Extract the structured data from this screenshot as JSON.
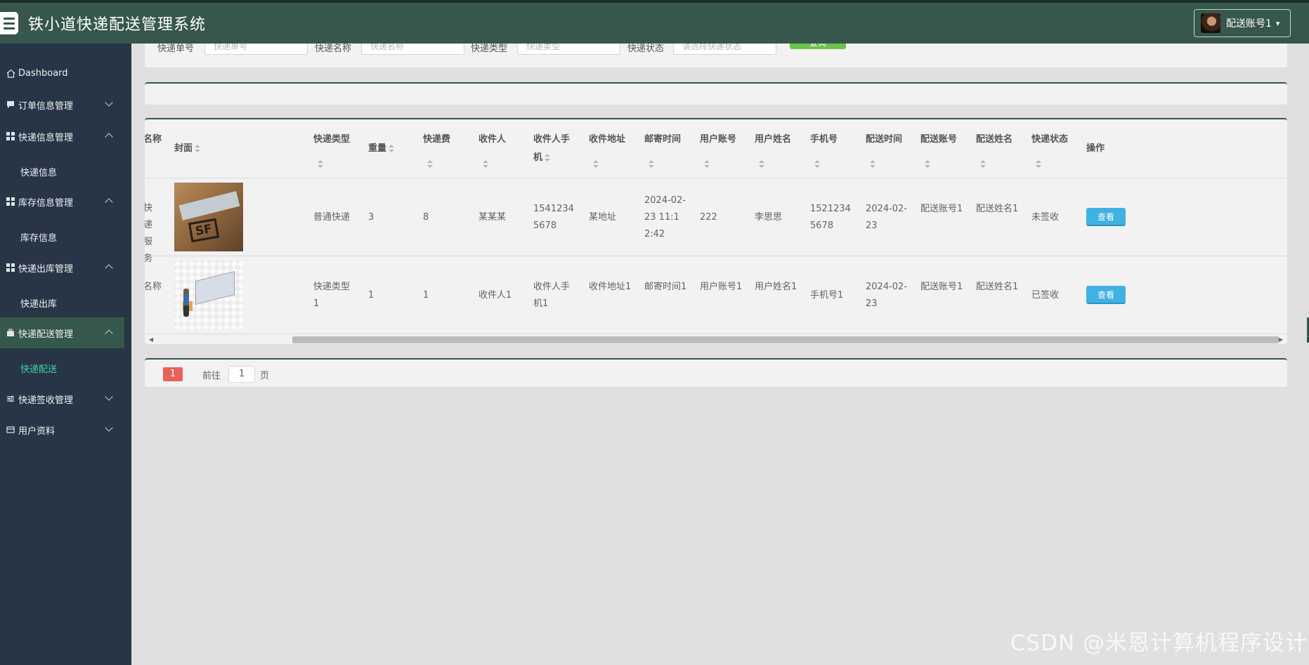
{
  "header": {
    "title": "铁小道快递配送管理系统",
    "user_label": "配送账号1",
    "caret": "▾"
  },
  "sidebar": {
    "items": [
      {
        "label": "Dashboard"
      },
      {
        "label": "订单信息管理"
      },
      {
        "label": "快递信息管理"
      },
      {
        "label": "快递信息"
      },
      {
        "label": "库存信息管理"
      },
      {
        "label": "库存信息"
      },
      {
        "label": "快递出库管理"
      },
      {
        "label": "快递出库"
      },
      {
        "label": "快递配送管理"
      },
      {
        "label": "快递配送"
      },
      {
        "label": "快递签收管理"
      },
      {
        "label": "用户资料"
      }
    ]
  },
  "search": {
    "labels": [
      "快递单号",
      "快递名称",
      "快递类型",
      "快递状态"
    ],
    "placeholders": [
      "快递单号",
      "快递名称",
      "快递类型",
      "请选择快递状态"
    ],
    "button": "查询"
  },
  "table": {
    "headers": [
      "名称",
      "封面",
      "快递类型",
      "重量",
      "快递费",
      "收件人",
      "收件人手机",
      "收件地址",
      "邮寄时间",
      "用户账号",
      "用户姓名",
      "手机号",
      "配送时间",
      "配送账号",
      "配送姓名",
      "快递状态",
      "操作"
    ],
    "rows": [
      {
        "name": "快递服务",
        "type": "普通快递",
        "weight": "3",
        "fee": "8",
        "receiver": "某某某",
        "receiver_phone": "15412345678",
        "address": "某地址",
        "mail_time": "2024-02-23 11:12:42",
        "user_account": "222",
        "user_name": "李思思",
        "phone": "15212345678",
        "delivery_time": "2024-02-23",
        "delivery_account": "配送账号1",
        "delivery_name": "配送姓名1",
        "status": "未签收",
        "action": "查看"
      },
      {
        "name": "名称",
        "type": "快递类型1",
        "weight": "1",
        "fee": "1",
        "receiver": "收件人1",
        "receiver_phone": "收件人手机1",
        "address": "收件地址1",
        "mail_time": "邮寄时间1",
        "user_account": "用户账号1",
        "user_name": "用户姓名1",
        "phone": "手机号1",
        "delivery_time": "2024-02-23",
        "delivery_account": "配送账号1",
        "delivery_name": "配送姓名1",
        "status": "已签收",
        "action": "查看"
      }
    ]
  },
  "pagination": {
    "current": "1",
    "goto_prefix": "前往",
    "goto_value": "1",
    "goto_suffix": "页"
  },
  "watermark": "CSDN @米恩计算机程序设计",
  "colors": {
    "header": "#36574a",
    "sidebar": "#273646",
    "active_sub": "#3fd3a6",
    "view_button": "#3fb1e3",
    "page_active": "#e8615a",
    "search_button": "#6cc24a"
  }
}
